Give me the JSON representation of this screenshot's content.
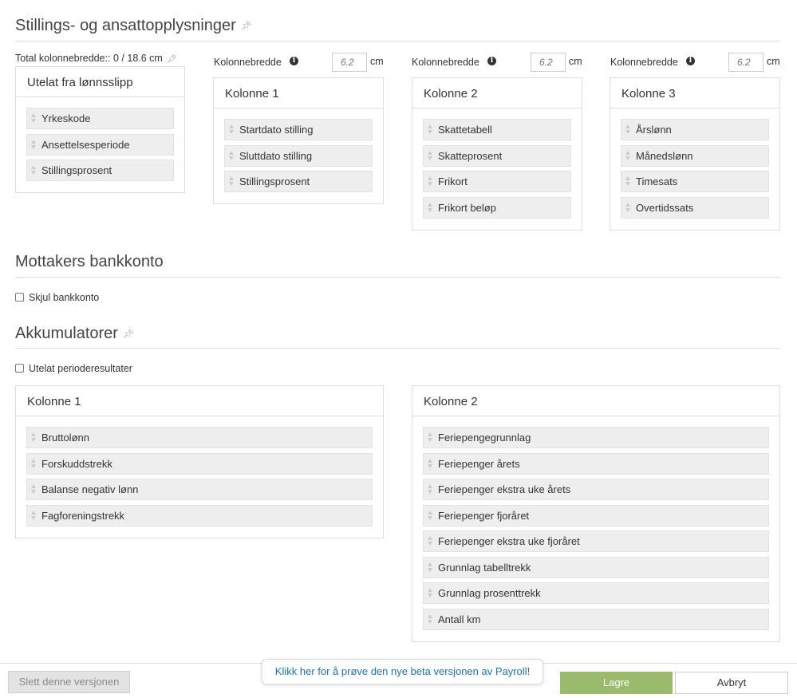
{
  "section1": {
    "title": "Stillings- og ansattopplysninger",
    "total_width_label": "Total kolonnebredde:: 0 / 18.6 cm",
    "excluded": {
      "title": "Utelat fra lønnsslipp",
      "items": [
        "Yrkeskode",
        "Ansettelsesperiode",
        "Stillingsprosent"
      ]
    },
    "columns": [
      {
        "width_label": "Kolonnebredde",
        "width_placeholder": "6.2",
        "unit": "cm",
        "title": "Kolonne 1",
        "items": [
          "Startdato stilling",
          "Sluttdato stilling",
          "Stillingsprosent"
        ]
      },
      {
        "width_label": "Kolonnebredde",
        "width_placeholder": "6.2",
        "unit": "cm",
        "title": "Kolonne 2",
        "items": [
          "Skattetabell",
          "Skatteprosent",
          "Frikort",
          "Frikort beløp"
        ]
      },
      {
        "width_label": "Kolonnebredde",
        "width_placeholder": "6.2",
        "unit": "cm",
        "title": "Kolonne 3",
        "items": [
          "Årslønn",
          "Månedslønn",
          "Timesats",
          "Overtidssats"
        ]
      }
    ]
  },
  "section2": {
    "title": "Mottakers bankkonto",
    "checkbox_label": "Skjul bankkonto"
  },
  "section3": {
    "title": "Akkumulatorer",
    "checkbox_label": "Utelat perioderesultater",
    "columns": [
      {
        "title": "Kolonne 1",
        "items": [
          "Bruttolønn",
          "Forskuddstrekk",
          "Balanse negativ lønn",
          "Fagforeningstrekk"
        ]
      },
      {
        "title": "Kolonne 2",
        "items": [
          "Feriepengegrunnlag",
          "Feriepenger årets",
          "Feriepenger ekstra uke årets",
          "Feriepenger fjoråret",
          "Feriepenger ekstra uke fjoråret",
          "Grunnlag tabelltrekk",
          "Grunnlag prosenttrekk",
          "Antall km"
        ]
      }
    ]
  },
  "footer": {
    "delete_label": "Slett denne versjonen",
    "beta_banner": "Klikk her for å prøve den nye beta versjonen av Payroll!",
    "save_label": "Lagre",
    "cancel_label": "Avbryt"
  },
  "colors": {
    "save_button": "#9aba6c",
    "link_blue": "#1a72b8",
    "item_bg": "#eeeeee"
  },
  "icons": [
    "pin-icon",
    "info-icon",
    "drag-handle-icon"
  ]
}
